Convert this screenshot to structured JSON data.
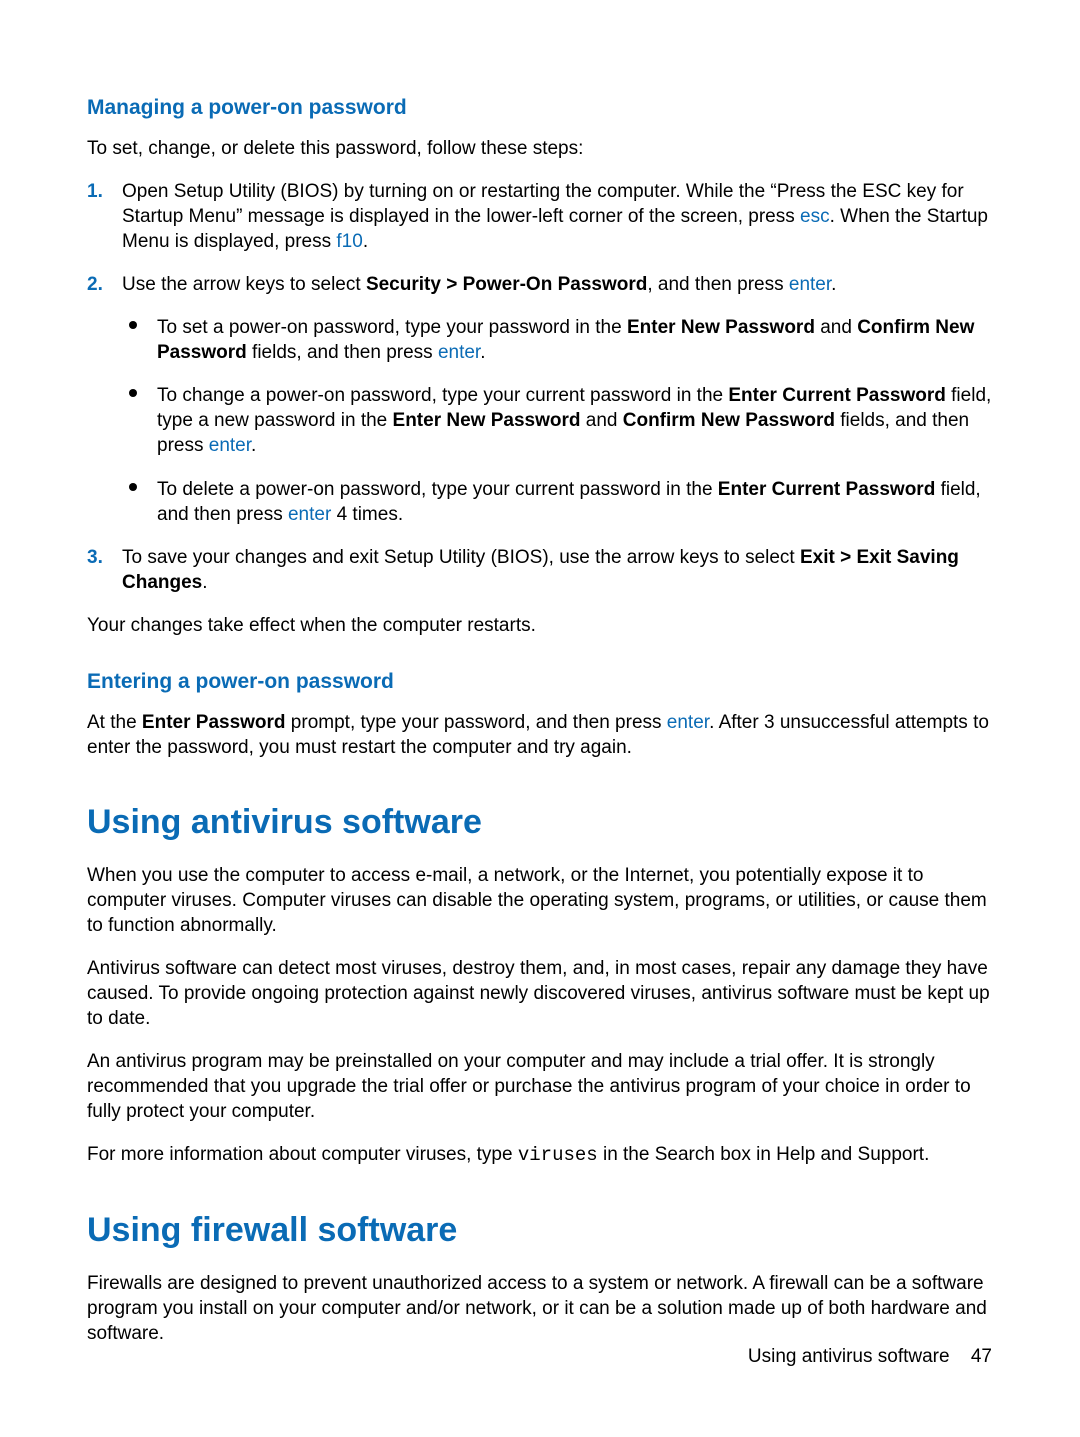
{
  "section1": {
    "heading": "Managing a power-on password",
    "intro": "To set, change, or delete this password, follow these steps:",
    "steps": [
      {
        "num": "1.",
        "parts": [
          {
            "t": "Open Setup Utility (BIOS) by turning on or restarting the computer. While the “Press the ESC key for Startup Menu” message is displayed in the lower-left corner of the screen, press "
          },
          {
            "t": "esc",
            "cls": "key"
          },
          {
            "t": ". When the Startup Menu is displayed, press "
          },
          {
            "t": "f10",
            "cls": "key"
          },
          {
            "t": "."
          }
        ]
      },
      {
        "num": "2.",
        "parts": [
          {
            "t": "Use the arrow keys to select "
          },
          {
            "t": "Security > Power-On Password",
            "cls": "b"
          },
          {
            "t": ", and then press "
          },
          {
            "t": "enter",
            "cls": "key"
          },
          {
            "t": "."
          }
        ],
        "bullets": [
          [
            {
              "t": "To set a power-on password, type your password in the "
            },
            {
              "t": "Enter New Password",
              "cls": "b"
            },
            {
              "t": " and "
            },
            {
              "t": "Confirm New Password",
              "cls": "b"
            },
            {
              "t": " fields, and then press "
            },
            {
              "t": "enter",
              "cls": "key"
            },
            {
              "t": "."
            }
          ],
          [
            {
              "t": "To change a power-on password, type your current password in the "
            },
            {
              "t": "Enter Current Password",
              "cls": "b"
            },
            {
              "t": " field, type a new password in the "
            },
            {
              "t": "Enter New Password",
              "cls": "b"
            },
            {
              "t": " and "
            },
            {
              "t": "Confirm New Password",
              "cls": "b"
            },
            {
              "t": " fields, and then press "
            },
            {
              "t": "enter",
              "cls": "key"
            },
            {
              "t": "."
            }
          ],
          [
            {
              "t": "To delete a power-on password, type your current password in the "
            },
            {
              "t": "Enter Current Password",
              "cls": "b"
            },
            {
              "t": " field, and then press "
            },
            {
              "t": "enter",
              "cls": "key"
            },
            {
              "t": " 4 times."
            }
          ]
        ]
      },
      {
        "num": "3.",
        "parts": [
          {
            "t": "To save your changes and exit Setup Utility (BIOS), use the arrow keys to select "
          },
          {
            "t": "Exit > Exit Saving Changes",
            "cls": "b"
          },
          {
            "t": "."
          }
        ]
      }
    ],
    "outro": "Your changes take effect when the computer restarts."
  },
  "section2": {
    "heading": "Entering a power-on password",
    "paragraph_parts": [
      {
        "t": "At the "
      },
      {
        "t": "Enter Password",
        "cls": "b"
      },
      {
        "t": " prompt, type your password, and then press "
      },
      {
        "t": "enter",
        "cls": "key"
      },
      {
        "t": ". After 3 unsuccessful attempts to enter the password, you must restart the computer and try again."
      }
    ]
  },
  "section3": {
    "heading": "Using antivirus software",
    "paras": [
      [
        {
          "t": "When you use the computer to access e-mail, a network, or the Internet, you potentially expose it to computer viruses. Computer viruses can disable the operating system, programs, or utilities, or cause them to function abnormally."
        }
      ],
      [
        {
          "t": "Antivirus software can detect most viruses, destroy them, and, in most cases, repair any damage they have caused. To provide ongoing protection against newly discovered viruses, antivirus software must be kept up to date."
        }
      ],
      [
        {
          "t": "An antivirus program may be preinstalled on your computer and may include a trial offer. It is strongly recommended that you upgrade the trial offer or purchase the antivirus program of your choice in order to fully protect your computer."
        }
      ],
      [
        {
          "t": "For more information about computer viruses, type "
        },
        {
          "t": "viruses",
          "cls": "mono"
        },
        {
          "t": " in the Search box in Help and Support."
        }
      ]
    ]
  },
  "section4": {
    "heading": "Using firewall software",
    "paras": [
      [
        {
          "t": "Firewalls are designed to prevent unauthorized access to a system or network. A firewall can be a software program you install on your computer and/or network, or it can be a solution made up of both hardware and software."
        }
      ]
    ]
  },
  "footer": {
    "title": "Using antivirus software",
    "page": "47"
  }
}
